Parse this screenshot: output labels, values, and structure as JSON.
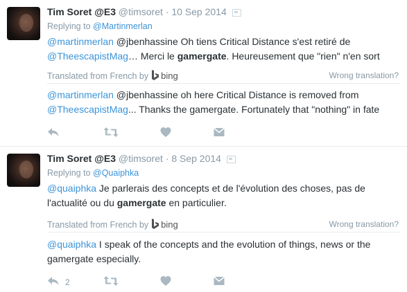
{
  "tweets": [
    {
      "name": "Tim Soret @E3",
      "handle": "@timsoret",
      "sep": "·",
      "date": "10 Sep 2014",
      "replying_prefix": "Replying to ",
      "replying_to": "@Martinmerlan",
      "original_line1": {
        "m1": "@martinmerlan",
        "t1": " @jbenhassine Oh tiens Critical Distance s'est retiré de"
      },
      "original_line2": {
        "m2": "@TheescapistMag",
        "t2": "… Merci le ",
        "b": "gamergate",
        "t3": ". Heureusement que \"rien\" n'en sort"
      },
      "translated_from": "Translated from French by",
      "bing": "bing",
      "wrong_translation": "Wrong translation?",
      "translation_line1": {
        "m1": "@martinmerlan",
        "t1": " @jbenhassine oh here Critical Distance is removed from"
      },
      "translation_line2": {
        "m2": "@TheescapistMag",
        "t2": "... Thanks the gamergate. Fortunately that \"nothing\" in fate"
      },
      "reply_count": ""
    },
    {
      "name": "Tim Soret @E3",
      "handle": "@timsoret",
      "sep": "·",
      "date": "8 Sep 2014",
      "replying_prefix": "Replying to ",
      "replying_to": "@Quaiphka",
      "original_line1": {
        "m1": "@quaiphka",
        "t1": " Je parlerais des concepts et de l'évolution des choses, pas de"
      },
      "original_line2": {
        "t2": "l'actualité ou du ",
        "b": "gamergate",
        "t3": " en particulier."
      },
      "translated_from": "Translated from French by",
      "bing": "bing",
      "wrong_translation": "Wrong translation?",
      "translation_line1": {
        "m1": "@quaiphka",
        "t1": " I speak of the concepts and the evolution of things, news or the"
      },
      "translation_line2": {
        "t2": "gamergate especially."
      },
      "reply_count": "2"
    }
  ],
  "icons": {
    "reply": "reply-icon",
    "retweet": "retweet-icon",
    "like": "heart-icon",
    "dm": "envelope-icon",
    "media": "media-icon",
    "bing": "bing-logo-icon"
  },
  "colors": {
    "link": "#3b94d9",
    "muted": "#8899a6",
    "text": "#292f33",
    "action_icon": "#aab8c2",
    "divider": "#e6ecf0"
  }
}
